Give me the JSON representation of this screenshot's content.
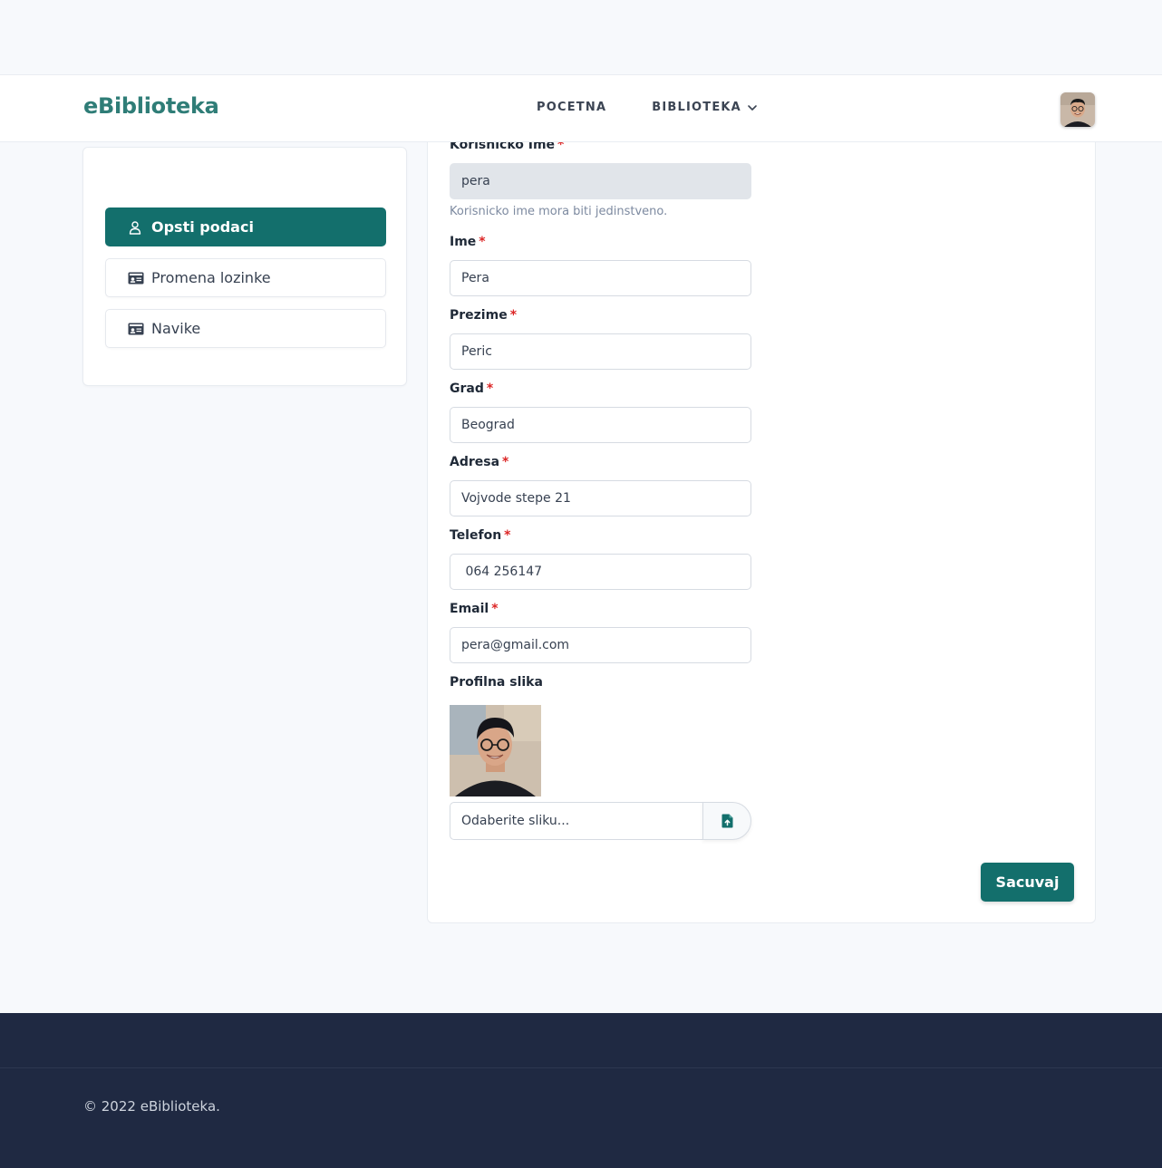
{
  "navbar": {
    "brand": "eBiblioteka",
    "links": [
      {
        "label": "POCETNA"
      },
      {
        "label": "BIBLIOTEKA"
      }
    ]
  },
  "sidebar": {
    "items": [
      {
        "label": "Opsti podaci",
        "icon": "user-icon",
        "active": true
      },
      {
        "label": "Promena lozinke",
        "icon": "id-card-icon",
        "active": false
      },
      {
        "label": "Navike",
        "icon": "id-card-icon",
        "active": false
      }
    ]
  },
  "form": {
    "username": {
      "label": "Korisnicko Ime",
      "value": "pera",
      "help": "Korisnicko ime mora biti jedinstveno."
    },
    "first_name": {
      "label": "Ime",
      "value": "Pera"
    },
    "last_name": {
      "label": "Prezime",
      "value": "Peric"
    },
    "city": {
      "label": "Grad",
      "value": "Beograd"
    },
    "address": {
      "label": "Adresa",
      "value": "Vojvode stepe 21"
    },
    "phone": {
      "label": "Telefon",
      "value": " 064 256147"
    },
    "email": {
      "label": "Email",
      "value": "pera@gmail.com"
    },
    "photo": {
      "label": "Profilna slika",
      "placeholder": "Odaberite sliku..."
    },
    "required_mark": "*",
    "save_label": "Sacuvaj"
  },
  "footer": {
    "copyright": "© 2022 eBiblioteka."
  },
  "colors": {
    "primary": "#136f6c",
    "brand": "#2f7d77",
    "footer_bg": "#1f2942",
    "required": "#dc2626"
  }
}
